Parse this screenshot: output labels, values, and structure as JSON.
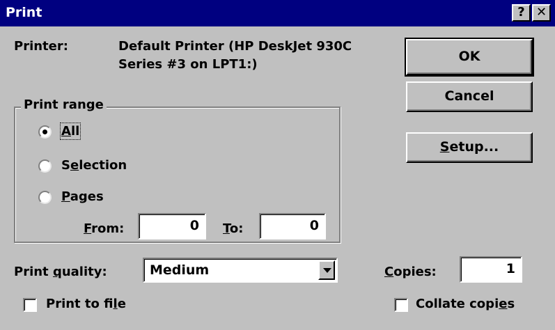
{
  "window": {
    "title": "Print",
    "help_label": "?",
    "close_label": "✕"
  },
  "printer": {
    "label": "Printer:",
    "name_line1": "Default Printer (HP DeskJet 930C",
    "name_line2": "Series #3 on LPT1:)"
  },
  "buttons": {
    "ok": "OK",
    "cancel": "Cancel",
    "setup_pre": "",
    "setup_key": "S",
    "setup_post": "etup..."
  },
  "print_range": {
    "legend": "Print range",
    "all": {
      "key": "A",
      "rest": "ll",
      "selected": true
    },
    "selection": {
      "pre": "S",
      "key": "e",
      "rest": "lection",
      "selected": false
    },
    "pages": {
      "key": "P",
      "rest": "ages",
      "selected": false
    },
    "from": {
      "key": "F",
      "rest": "rom:",
      "value": "0"
    },
    "to": {
      "key": "T",
      "rest": "o:",
      "value": "0"
    }
  },
  "quality": {
    "label_pre": "Print ",
    "label_key": "q",
    "label_post": "uality:",
    "value": "Medium"
  },
  "copies": {
    "label_key": "C",
    "label_rest": "opies:",
    "value": "1"
  },
  "print_to_file": {
    "pre": "Print to fi",
    "key": "l",
    "post": "e",
    "checked": false
  },
  "collate": {
    "pre": "Collate copi",
    "key": "e",
    "post": "s",
    "checked": false
  }
}
